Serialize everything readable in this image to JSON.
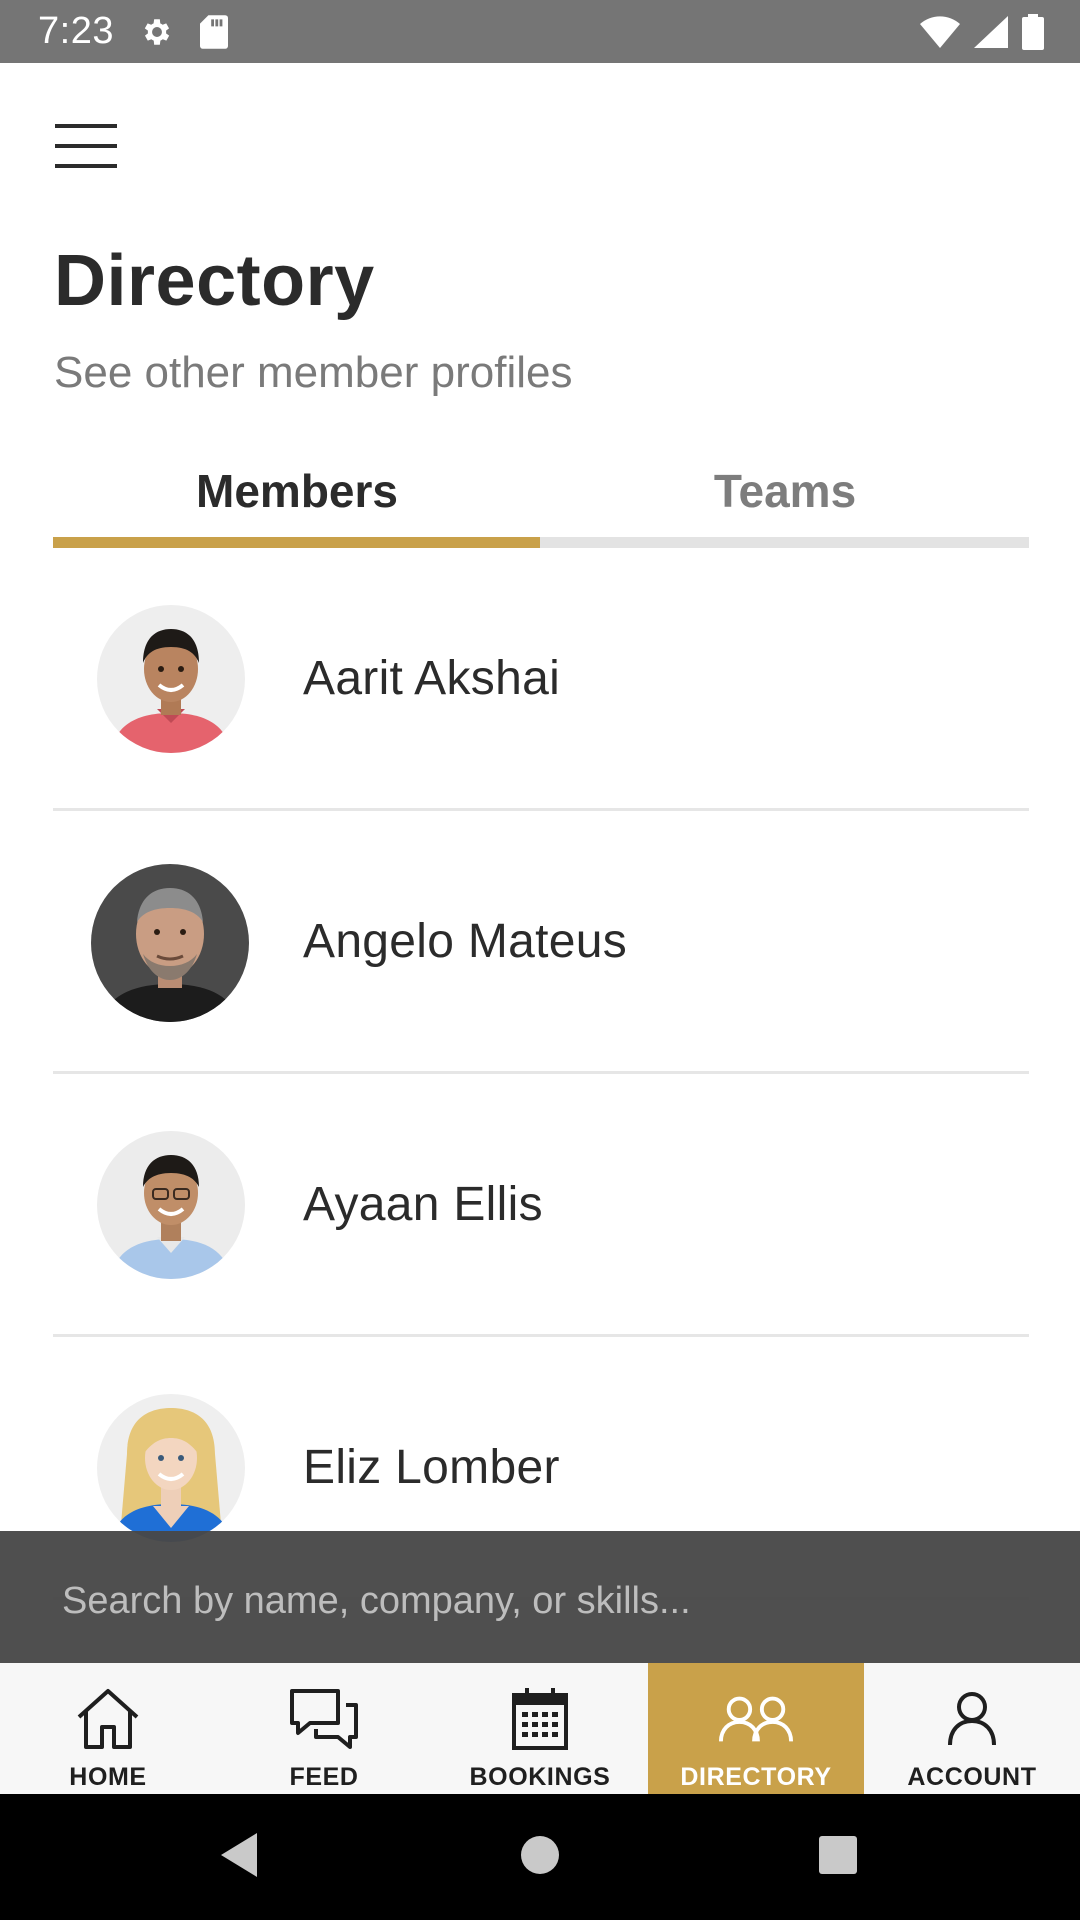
{
  "status_bar": {
    "time": "7:23"
  },
  "header": {
    "title": "Directory",
    "subtitle": "See other member profiles"
  },
  "tabs": [
    {
      "label": "Members",
      "active": true
    },
    {
      "label": "Teams",
      "active": false
    }
  ],
  "members": [
    {
      "name": "Aarit Akshai"
    },
    {
      "name": "Angelo Mateus"
    },
    {
      "name": "Ayaan Ellis"
    },
    {
      "name": "Eliz Lomber"
    }
  ],
  "search": {
    "placeholder": "Search by name, company, or skills...",
    "value": ""
  },
  "bottom_nav": {
    "items": [
      {
        "label": "HOME",
        "icon": "home-icon",
        "active": false
      },
      {
        "label": "FEED",
        "icon": "feed-icon",
        "active": false
      },
      {
        "label": "BOOKINGS",
        "icon": "calendar-icon",
        "active": false
      },
      {
        "label": "DIRECTORY",
        "icon": "people-icon",
        "active": true
      },
      {
        "label": "ACCOUNT",
        "icon": "person-icon",
        "active": false
      }
    ]
  },
  "colors": {
    "accent": "#c9a14a",
    "text_primary": "#2b2b2b",
    "text_secondary": "#7a7a7a",
    "status_bar": "#757575"
  }
}
